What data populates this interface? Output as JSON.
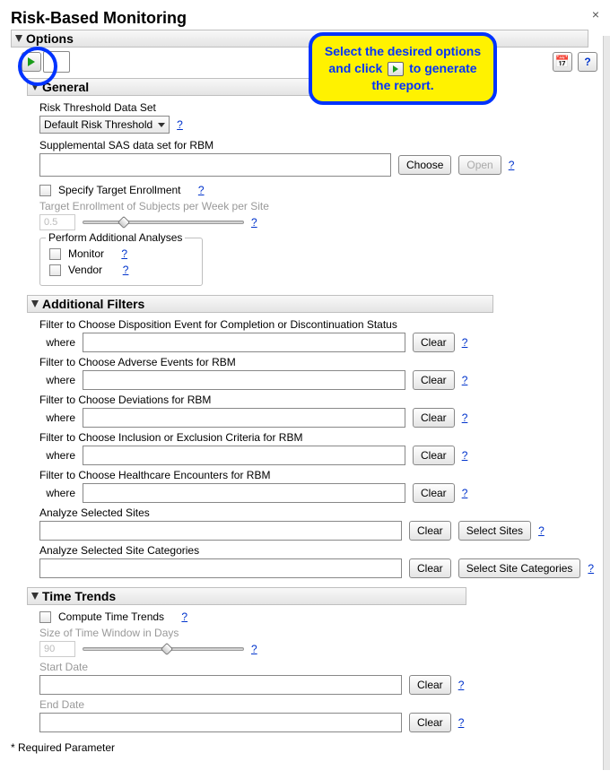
{
  "title": "Risk-Based Monitoring",
  "options_header": "Options",
  "callout": {
    "line1": "Select the desired options and click",
    "line2": "to generate the report."
  },
  "general": {
    "header": "General",
    "risk_threshold_label": "Risk Threshold Data Set",
    "risk_threshold_value": "Default Risk Threshold",
    "supplemental_label": "Supplemental SAS data set for RBM",
    "choose_btn": "Choose",
    "open_btn": "Open",
    "specify_target_label": "Specify Target Enrollment",
    "target_enroll_label": "Target Enrollment of Subjects per Week per Site",
    "target_enroll_value": "0.5",
    "perform_legend": "Perform Additional Analyses",
    "monitor_label": "Monitor",
    "vendor_label": "Vendor"
  },
  "filters": {
    "header": "Additional Filters",
    "where_label": "where",
    "clear_btn": "Clear",
    "f1": "Filter to Choose Disposition Event for Completion or Discontinuation Status",
    "f2": "Filter to Choose Adverse Events for RBM",
    "f3": "Filter to Choose Deviations for RBM",
    "f4": "Filter to Choose Inclusion or Exclusion Criteria for RBM",
    "f5": "Filter to Choose Healthcare Encounters for RBM",
    "analyze_sites_label": "Analyze Selected Sites",
    "select_sites_btn": "Select Sites",
    "analyze_cats_label": "Analyze Selected Site Categories",
    "select_cats_btn": "Select Site Categories"
  },
  "time": {
    "header": "Time Trends",
    "compute_label": "Compute Time Trends",
    "window_label": "Size of Time Window in Days",
    "window_value": "90",
    "start_label": "Start Date",
    "end_label": "End Date",
    "clear_btn": "Clear"
  },
  "footnote": "* Required Parameter",
  "help_q": "?"
}
